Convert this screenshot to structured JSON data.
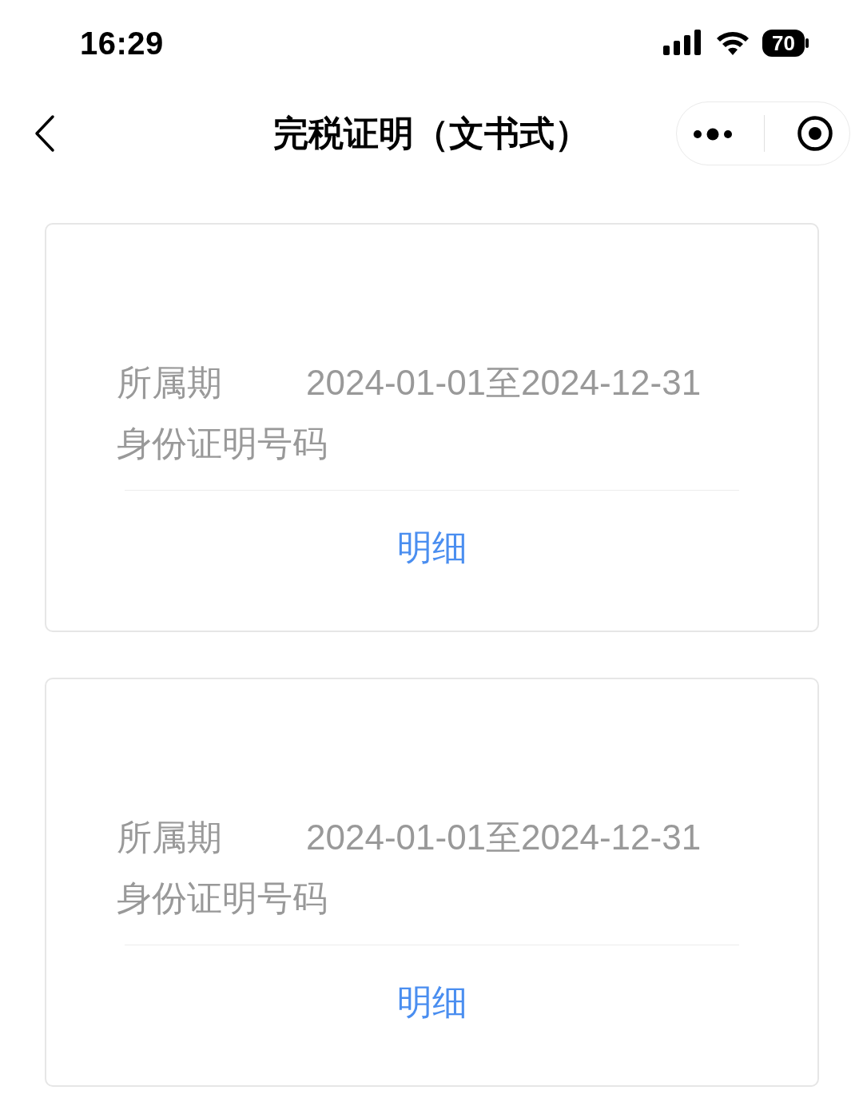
{
  "status_bar": {
    "time": "16:29",
    "battery": "70"
  },
  "nav": {
    "title": "完税证明（文书式）"
  },
  "records": [
    {
      "fields": [
        {
          "label": "所属期",
          "value": "2024-01-01至2024-12-31"
        },
        {
          "label": "身份证明号码"
        }
      ],
      "action": "明细"
    },
    {
      "fields": [
        {
          "label": "所属期",
          "value": "2024-01-01至2024-12-31"
        },
        {
          "label": "身份证明号码"
        }
      ],
      "action": "明细"
    }
  ]
}
